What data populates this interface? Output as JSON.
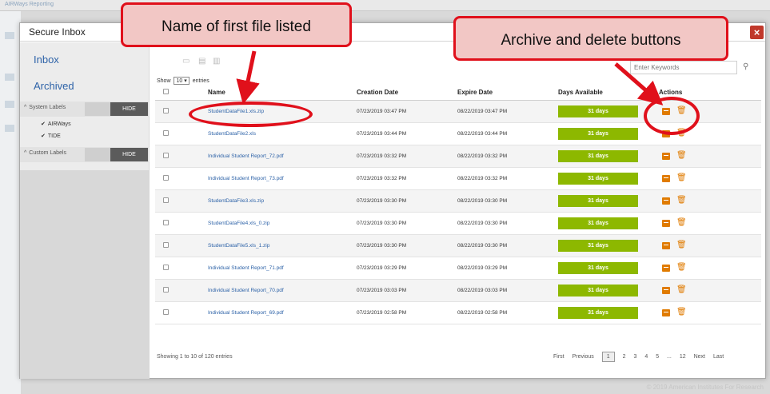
{
  "background": {
    "app_title": "AIRWays Reporting",
    "footer": "© 2019 American Institutes For Research"
  },
  "modal": {
    "title": "Secure Inbox",
    "close_glyph": "×"
  },
  "sidebar": {
    "inbox": "Inbox",
    "archived": "Archived",
    "system_labels": "System Labels",
    "custom_labels": "Custom Labels",
    "hide_label": "HIDE",
    "system_items": [
      "AIRWays",
      "TIDE"
    ]
  },
  "toolbar": {
    "search_placeholder": "Enter Keywords"
  },
  "entries": {
    "show_label": "Show",
    "show_value": "10",
    "entries_label": "entries"
  },
  "table": {
    "headers": [
      "Name",
      "Creation Date",
      "Expire Date",
      "Days Available",
      "Actions"
    ],
    "rows": [
      {
        "name": "StudentDataFile1.xls.zip",
        "created": "07/23/2019 03:47 PM",
        "expires": "08/22/2019 03:47 PM",
        "days": "31 days"
      },
      {
        "name": "StudentDataFile2.xls",
        "created": "07/23/2019 03:44 PM",
        "expires": "08/22/2019 03:44 PM",
        "days": "31 days"
      },
      {
        "name": "Individual Student Report_72.pdf",
        "created": "07/23/2019 03:32 PM",
        "expires": "08/22/2019 03:32 PM",
        "days": "31 days"
      },
      {
        "name": "Individual Student Report_73.pdf",
        "created": "07/23/2019 03:32 PM",
        "expires": "08/22/2019 03:32 PM",
        "days": "31 days"
      },
      {
        "name": "StudentDataFile3.xls.zip",
        "created": "07/23/2019 03:30 PM",
        "expires": "08/22/2019 03:30 PM",
        "days": "31 days"
      },
      {
        "name": "StudentDataFile4.xls_0.zip",
        "created": "07/23/2019 03:30 PM",
        "expires": "08/22/2019 03:30 PM",
        "days": "31 days"
      },
      {
        "name": "StudentDataFile5.xls_1.zip",
        "created": "07/23/2019 03:30 PM",
        "expires": "08/22/2019 03:30 PM",
        "days": "31 days"
      },
      {
        "name": "Individual Student Report_71.pdf",
        "created": "07/23/2019 03:29 PM",
        "expires": "08/22/2019 03:29 PM",
        "days": "31 days"
      },
      {
        "name": "Individual Student Report_70.pdf",
        "created": "07/23/2019 03:03 PM",
        "expires": "08/22/2019 03:03 PM",
        "days": "31 days"
      },
      {
        "name": "Individual Student Report_69.pdf",
        "created": "07/23/2019 02:58 PM",
        "expires": "08/22/2019 02:58 PM",
        "days": "31 days"
      }
    ]
  },
  "footer_info": {
    "showing": "Showing 1 to 10 of 120 entries"
  },
  "pagination": [
    "First",
    "Previous",
    "1",
    "2",
    "3",
    "4",
    "5",
    "...",
    "12",
    "Next",
    "Last"
  ],
  "annotations": {
    "callout_name": "Name of first file listed",
    "callout_actions": "Archive and delete buttons"
  },
  "colors": {
    "accent_red": "#e0101b",
    "days_green": "#8db800",
    "action_orange": "#e07b00",
    "link_blue": "#2e63a8"
  }
}
